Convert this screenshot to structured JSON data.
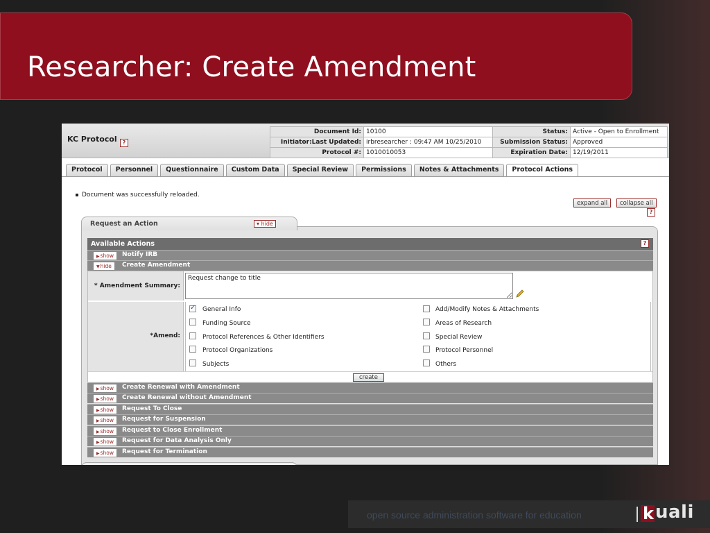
{
  "slide": {
    "title": "Researcher: Create Amendment",
    "footer_text": "open source administration software for education",
    "logo_k": "k",
    "logo_text": "uali",
    "accent_color": "#8f0f1f"
  },
  "doc_header": {
    "title": "KC Protocol",
    "help_glyph": "?",
    "document_id_label": "Document Id:",
    "document_id": "10100",
    "initiator_label": "Initiator:Last Updated:",
    "initiator": "irbresearcher : 09:47 AM 10/25/2010",
    "protocol_label": "Protocol #:",
    "protocol": "1010010053",
    "status_label": "Status:",
    "status": "Active - Open to Enrollment",
    "submission_label": "Submission Status:",
    "submission": "Approved",
    "expiration_label": "Expiration Date:",
    "expiration": "12/19/2011"
  },
  "tabs": [
    {
      "label": "Protocol",
      "active": false
    },
    {
      "label": "Personnel",
      "active": false
    },
    {
      "label": "Questionnaire",
      "active": false
    },
    {
      "label": "Custom Data",
      "active": false
    },
    {
      "label": "Special Review",
      "active": false
    },
    {
      "label": "Permissions",
      "active": false
    },
    {
      "label": "Notes & Attachments",
      "active": false
    },
    {
      "label": "Protocol Actions",
      "active": true
    }
  ],
  "message": "Document was successfully reloaded.",
  "controls": {
    "expand_all": "expand all",
    "collapse_all": "collapse all",
    "help_glyph": "?"
  },
  "panel": {
    "tab_label": "Request an Action",
    "hide_label": "hide",
    "available_actions": "Available Actions",
    "help_glyph": "?"
  },
  "actions": {
    "notify_irb": {
      "toggle": "show",
      "label": "Notify IRB"
    },
    "create_amendment": {
      "toggle": "hide",
      "label": "Create Amendment"
    },
    "rest": [
      {
        "toggle": "show",
        "label": "Create Renewal with Amendment"
      },
      {
        "toggle": "show",
        "label": "Create Renewal without Amendment"
      },
      {
        "toggle": "show",
        "label": "Request To Close"
      },
      {
        "toggle": "show",
        "label": "Request for Suspension"
      },
      {
        "toggle": "show",
        "label": "Request to Close Enrollment"
      },
      {
        "toggle": "show",
        "label": "Request for Data Analysis Only"
      },
      {
        "toggle": "show",
        "label": "Request for Termination"
      }
    ]
  },
  "amendment": {
    "summary_label": "* Amendment Summary:",
    "summary_value": "Request change to title",
    "amend_label": "*Amend:",
    "create_button": "create",
    "left_options": [
      {
        "label": "General Info",
        "checked": true
      },
      {
        "label": "Funding Source",
        "checked": false
      },
      {
        "label": "Protocol References & Other Identifiers",
        "checked": false
      },
      {
        "label": "Protocol Organizations",
        "checked": false
      },
      {
        "label": "Subjects",
        "checked": false
      }
    ],
    "right_options": [
      {
        "label": "Add/Modify Notes & Attachments",
        "checked": false
      },
      {
        "label": "Areas of Research",
        "checked": false
      },
      {
        "label": "Special Review",
        "checked": false
      },
      {
        "label": "Protocol Personnel",
        "checked": false
      },
      {
        "label": "Others",
        "checked": false
      }
    ]
  }
}
